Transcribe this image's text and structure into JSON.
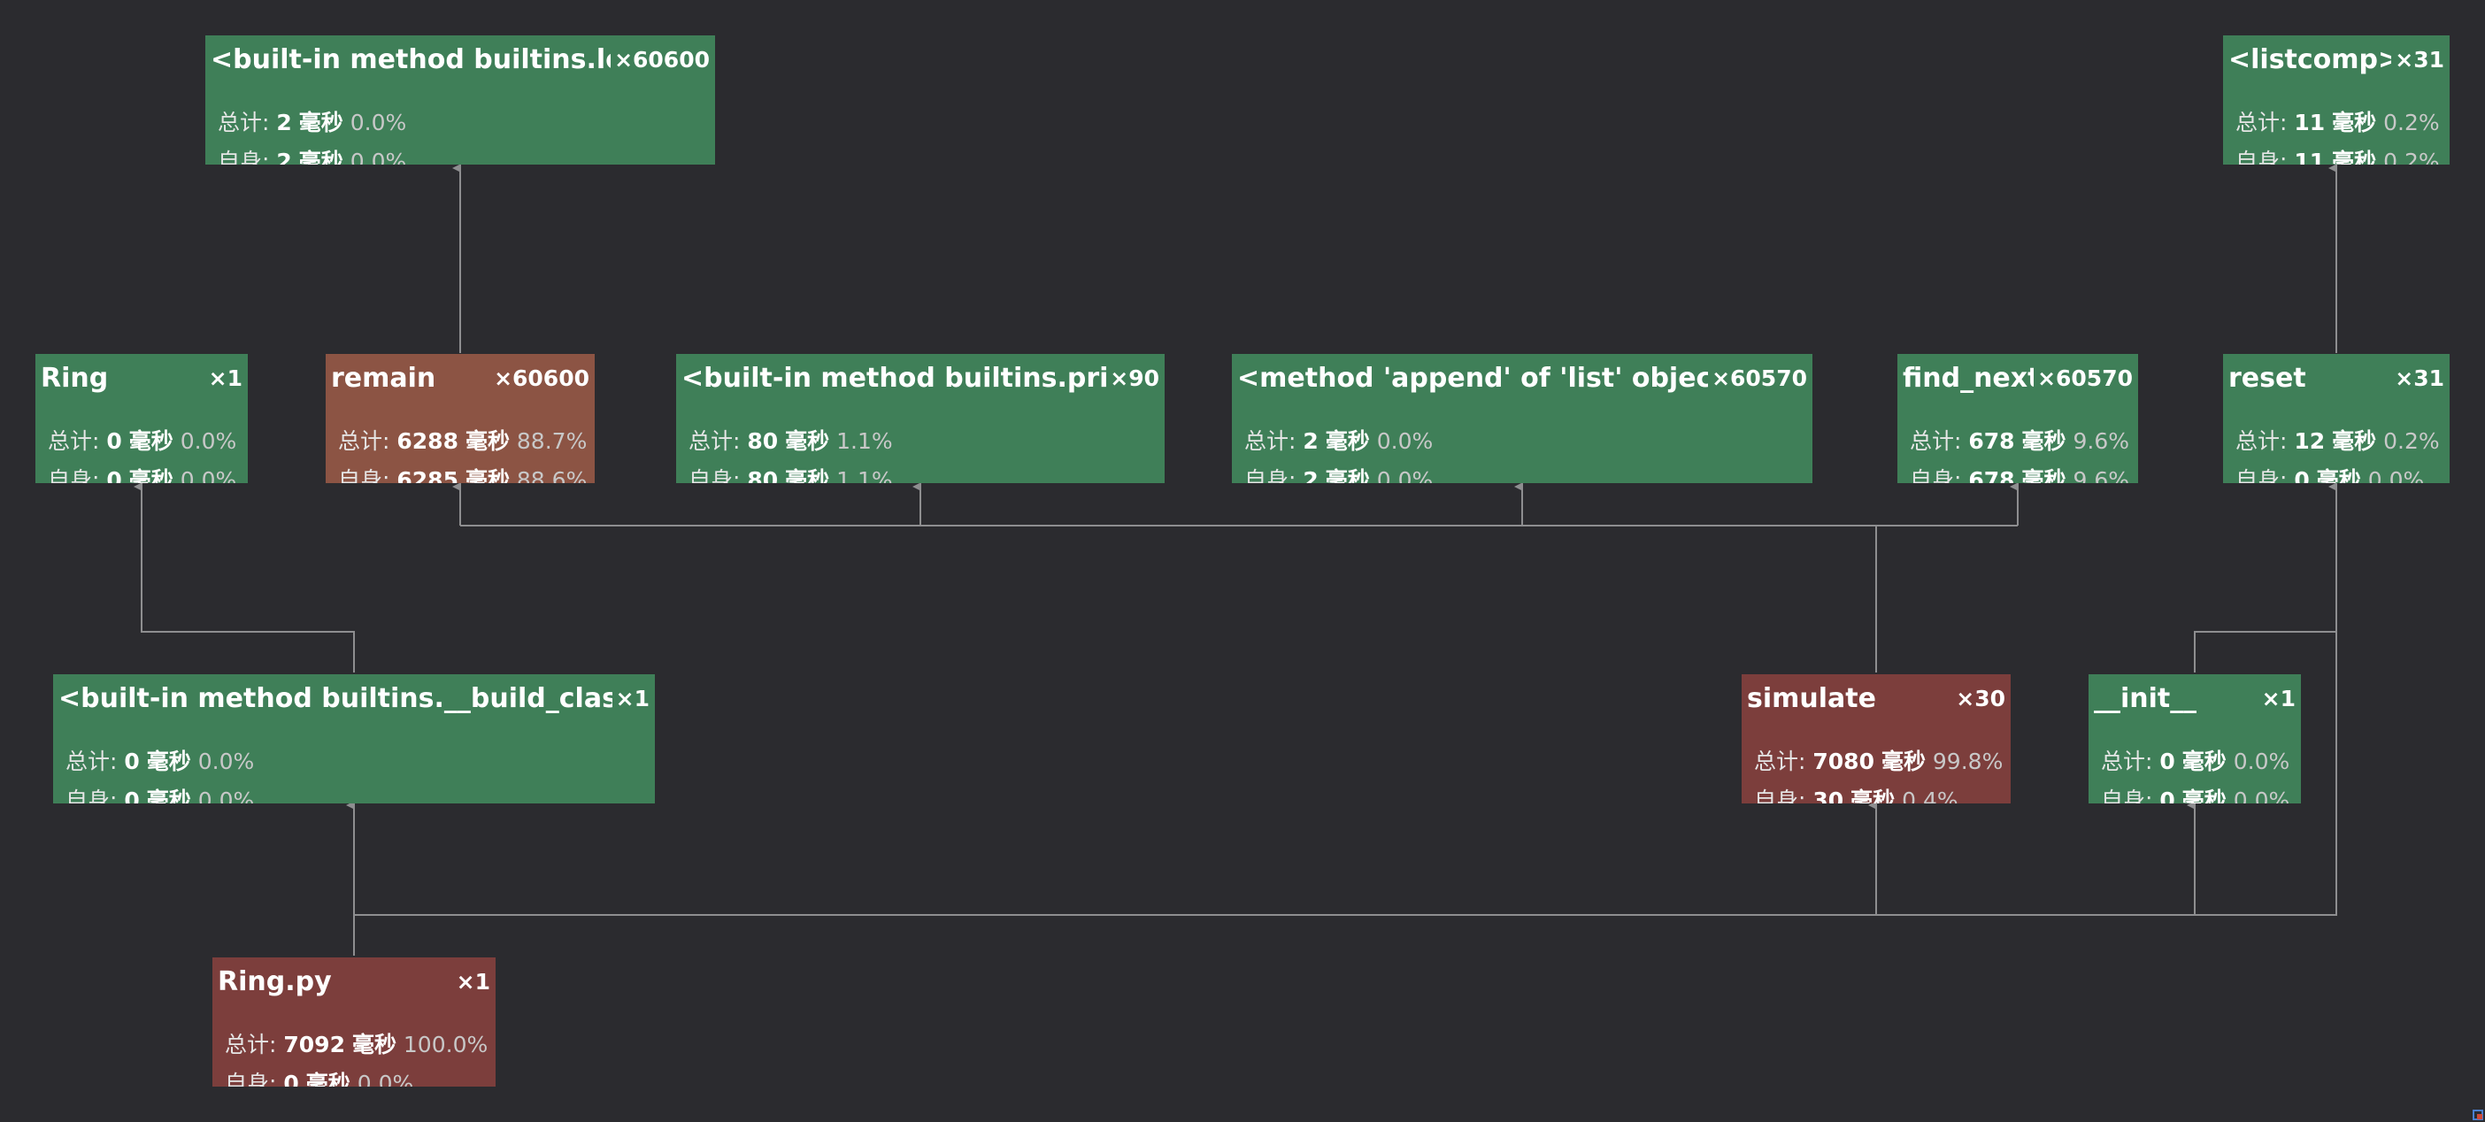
{
  "labels": {
    "total": "总计:",
    "self": "自身:",
    "unit": "毫秒"
  },
  "colors": {
    "background": "#2b2b2f",
    "normal": "#3f7f58",
    "hot": "#7c3e3c",
    "warm": "#8c5444",
    "edge": "#8e8e90"
  },
  "nodes": [
    {
      "name": "<built-in method builtins.len>",
      "count": "×60600",
      "total": "2",
      "total_pct": "0.0%",
      "self": "2",
      "self_pct": "0.0%"
    },
    {
      "name": "<listcomp>",
      "count": "×31",
      "total": "11",
      "total_pct": "0.2%",
      "self": "11",
      "self_pct": "0.2%"
    },
    {
      "name": "Ring",
      "count": "×1",
      "total": "0",
      "total_pct": "0.0%",
      "self": "0",
      "self_pct": "0.0%"
    },
    {
      "name": "remain",
      "count": "×60600",
      "total": "6288",
      "total_pct": "88.7%",
      "self": "6285",
      "self_pct": "88.6%"
    },
    {
      "name": "<built-in method builtins.print>",
      "count": "×90",
      "total": "80",
      "total_pct": "1.1%",
      "self": "80",
      "self_pct": "1.1%"
    },
    {
      "name": "<method 'append' of 'list' objects>",
      "count": "×60570",
      "total": "2",
      "total_pct": "0.0%",
      "self": "2",
      "self_pct": "0.0%"
    },
    {
      "name": "find_next",
      "count": "×60570",
      "total": "678",
      "total_pct": "9.6%",
      "self": "678",
      "self_pct": "9.6%"
    },
    {
      "name": "reset",
      "count": "×31",
      "total": "12",
      "total_pct": "0.2%",
      "self": "0",
      "self_pct": "0.0%"
    },
    {
      "name": "<built-in method builtins.__build_class__>",
      "count": "×1",
      "total": "0",
      "total_pct": "0.0%",
      "self": "0",
      "self_pct": "0.0%"
    },
    {
      "name": "simulate",
      "count": "×30",
      "total": "7080",
      "total_pct": "99.8%",
      "self": "30",
      "self_pct": "0.4%"
    },
    {
      "name": "__init__",
      "count": "×1",
      "total": "0",
      "total_pct": "0.0%",
      "self": "0",
      "self_pct": "0.0%"
    },
    {
      "name": "Ring.py",
      "count": "×1",
      "total": "7092",
      "total_pct": "100.0%",
      "self": "0",
      "self_pct": "0.0%"
    }
  ]
}
